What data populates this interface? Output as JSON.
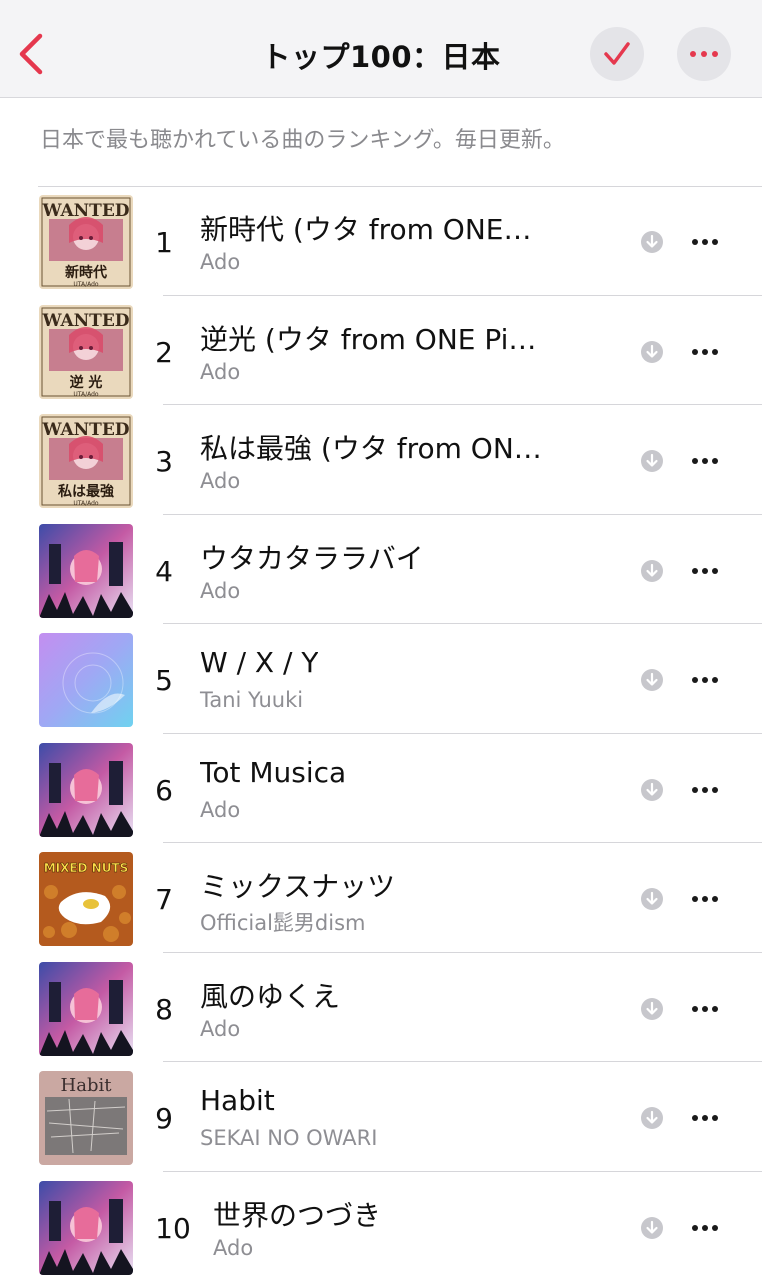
{
  "nav": {
    "title": "トップ100：日本",
    "accent_color": "#e5384e",
    "back_icon": "chevron-left-icon",
    "check_icon": "checkmark-icon",
    "more_icon": "ellipsis-icon"
  },
  "description": "日本で最も聴かれている曲のランキング。毎日更新。",
  "tracks": [
    {
      "rank": "1",
      "title": "新時代 (ウタ from ONE…",
      "artist": "Ado",
      "art": "wanted",
      "art_text": "新時代",
      "art_sub": "UTA/Ado"
    },
    {
      "rank": "2",
      "title": "逆光 (ウタ from ONE Pi…",
      "artist": "Ado",
      "art": "wanted",
      "art_text": "逆 光",
      "art_sub": "UTA/Ado"
    },
    {
      "rank": "3",
      "title": "私は最強 (ウタ from ON…",
      "artist": "Ado",
      "art": "wanted",
      "art_text": "私は最強",
      "art_sub": "UTA/Ado"
    },
    {
      "rank": "4",
      "title": "ウタカタララバイ",
      "artist": "Ado",
      "art": "film"
    },
    {
      "rank": "5",
      "title": "W / X / Y",
      "artist": "Tani Yuuki",
      "art": "gradient"
    },
    {
      "rank": "6",
      "title": "Tot Musica",
      "artist": "Ado",
      "art": "film"
    },
    {
      "rank": "7",
      "title": "ミックスナッツ",
      "artist": "Official髭男dism",
      "art": "mixed",
      "art_text": "MIXED NUTS"
    },
    {
      "rank": "8",
      "title": "風のゆくえ",
      "artist": "Ado",
      "art": "film"
    },
    {
      "rank": "9",
      "title": "Habit",
      "artist": "SEKAI NO OWARI",
      "art": "habit",
      "art_text": "Habit"
    },
    {
      "rank": "10",
      "title": "世界のつづき",
      "artist": "Ado",
      "art": "film"
    }
  ],
  "art_wanted_label": "WANTED",
  "download_icon": "download-icon",
  "row_more_icon": "ellipsis-icon"
}
